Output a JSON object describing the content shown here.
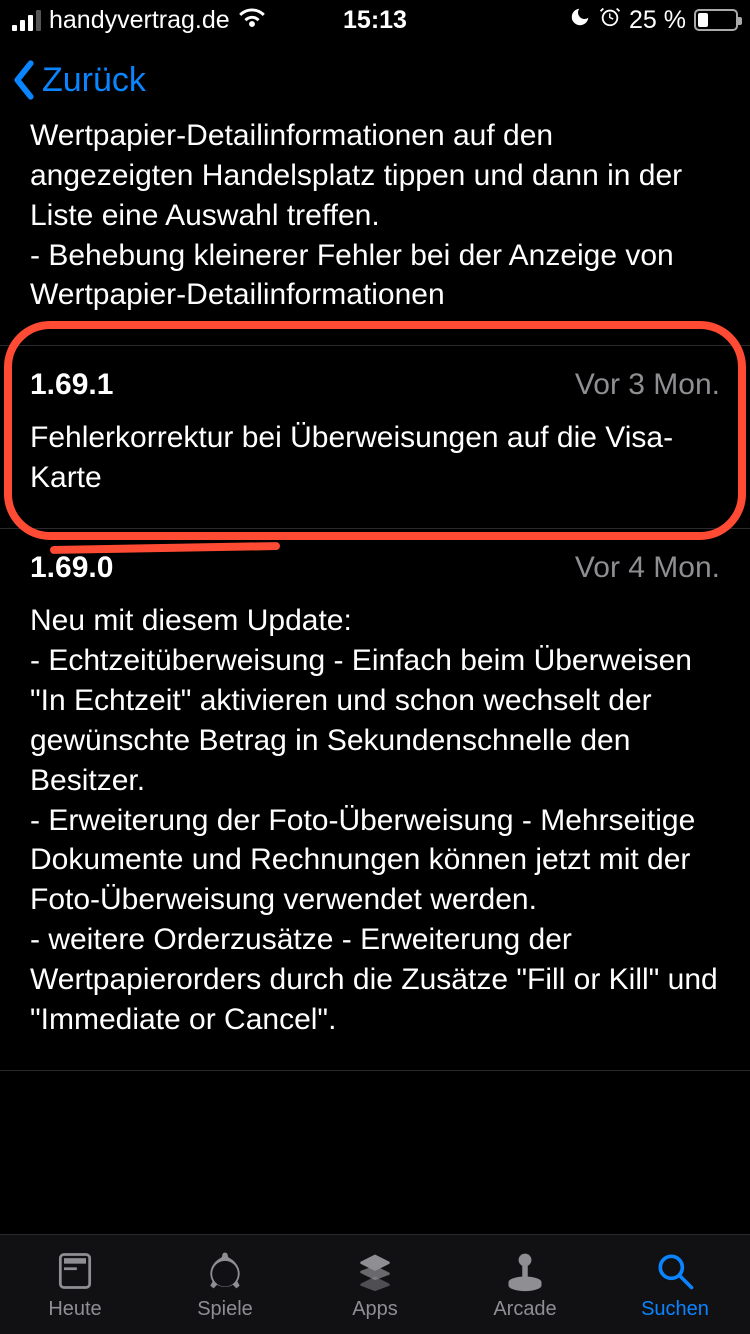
{
  "status": {
    "carrier": "handyvertrag.de",
    "time": "15:13",
    "battery_pct_label": "25 %",
    "battery_pct": 25
  },
  "nav": {
    "back_label": "Zurück"
  },
  "versions": [
    {
      "number": "",
      "age": "",
      "body": "angezeigt werden. Hierzu einfach in den Wertpapier-Detailinformationen auf den angezeigten Handelsplatz tippen und dann in der Liste eine Auswahl treffen.\n- Behebung kleinerer Fehler bei der Anzeige von Wertpapier-Detailinformationen"
    },
    {
      "number": "1.69.1",
      "age": "Vor 3 Mon.",
      "body": "Fehlerkorrektur bei Überweisungen auf die Visa-Karte",
      "highlighted": true
    },
    {
      "number": "1.69.0",
      "age": "Vor 4 Mon.",
      "body": "Neu mit diesem Update:\n- Echtzeitüberweisung - Einfach beim Überweisen \"In Echtzeit\" aktivieren und schon wechselt der gewünschte Betrag in Sekundenschnelle den Besitzer.\n- Erweiterung der Foto-Überweisung - Mehrseitige Dokumente und Rechnungen können jetzt mit der Foto-Überweisung verwendet werden.\n- weitere Orderzusätze - Erweiterung der Wertpapierorders durch die Zusätze \"Fill or Kill\" und \"Immediate or Cancel\"."
    },
    {
      "number": "",
      "age": "",
      "body": "__trailing_divider__"
    }
  ],
  "tabs": [
    {
      "key": "today",
      "label": "Heute"
    },
    {
      "key": "games",
      "label": "Spiele"
    },
    {
      "key": "apps",
      "label": "Apps"
    },
    {
      "key": "arcade",
      "label": "Arcade"
    },
    {
      "key": "search",
      "label": "Suchen",
      "active": true
    }
  ],
  "colors": {
    "accent": "#0a84ff",
    "highlight": "#ff4b33",
    "secondary_text": "#8e8e93"
  }
}
